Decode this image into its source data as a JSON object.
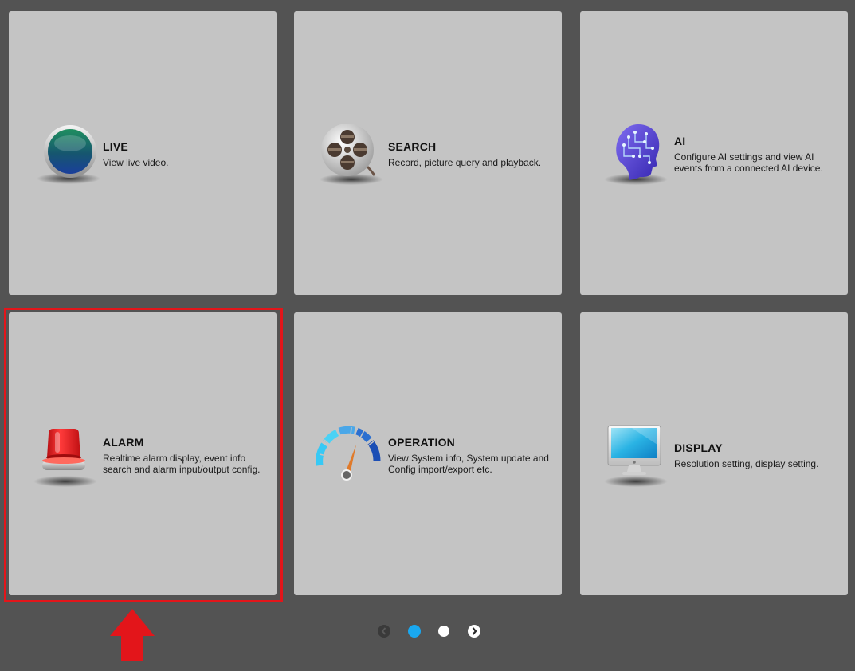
{
  "tiles": [
    {
      "title": "LIVE",
      "desc": "View live video."
    },
    {
      "title": "SEARCH",
      "desc": "Record, picture query and playback."
    },
    {
      "title": "AI",
      "desc": "Configure AI settings and view AI events from a connected AI device."
    },
    {
      "title": "ALARM",
      "desc": "Realtime alarm display, event info search and alarm input/output config."
    },
    {
      "title": "OPERATION",
      "desc": "View System info, System update and Config import/export etc."
    },
    {
      "title": "DISPLAY",
      "desc": "Resolution setting, display setting."
    }
  ],
  "pager": {
    "pages": 2,
    "current": 1
  },
  "colors": {
    "background": "#535353",
    "tile": "#c4c4c4",
    "highlight": "#e3151a",
    "active_dot": "#19a8f0"
  },
  "icons": [
    "live-icon",
    "search-film-reel-icon",
    "ai-head-icon",
    "alarm-siren-icon",
    "operation-gauge-icon",
    "display-monitor-icon"
  ]
}
